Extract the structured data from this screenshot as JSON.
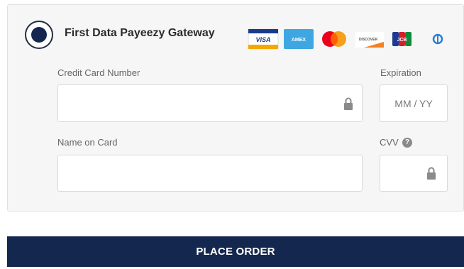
{
  "gateway": {
    "title": "First Data Payeezy Gateway",
    "selected": true,
    "card_logos": [
      "visa-icon",
      "amex-icon",
      "mastercard-icon",
      "discover-icon",
      "jcb-icon",
      "diners-icon"
    ],
    "logo_text": {
      "visa": "VISA",
      "amex": "AMEX",
      "discover": "DISCOVER",
      "jcb": "JCB"
    }
  },
  "form": {
    "card_number": {
      "label": "Credit Card Number",
      "value": "",
      "placeholder": ""
    },
    "expiration": {
      "label": "Expiration",
      "value": "",
      "placeholder": "MM / YY"
    },
    "name_on_card": {
      "label": "Name on Card",
      "value": "",
      "placeholder": ""
    },
    "cvv": {
      "label": "CVV",
      "value": "",
      "placeholder": "",
      "help_glyph": "?"
    }
  },
  "actions": {
    "place_order_label": "PLACE ORDER"
  },
  "colors": {
    "primary": "#13274f",
    "panel_bg": "#f6f6f6",
    "field_border": "#d9d9d9"
  }
}
